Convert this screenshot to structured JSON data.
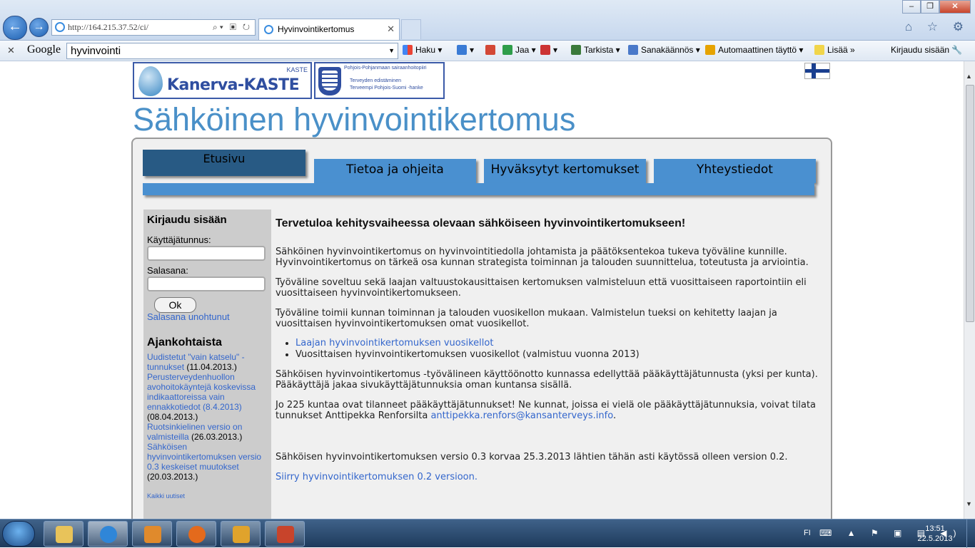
{
  "browser": {
    "address": "http://164.215.37.52/ci/",
    "tab_title": "Hyvinvointikertomus",
    "window_buttons": [
      "–",
      "❐",
      "✕"
    ],
    "right_icons": "⌂ ☆ ⚙"
  },
  "google_bar": {
    "logo": "Google",
    "search_value": "hyvinvointi",
    "items": {
      "haku": "Haku ▾",
      "jaa": "Jaa ▾",
      "tarkista": "Tarkista ▾",
      "sanakaannos": "Sanakäännös ▾",
      "autofill": "Automaattinen täyttö ▾",
      "lisaa": "Lisää »",
      "login": "Kirjaudu sisään"
    }
  },
  "header": {
    "logo1_name": "Kanerva-KASTE",
    "logo1_tag": "KASTE",
    "logo2_line1": "Pohjois-Pohjanmaan sairaanhoitopiiri",
    "logo2_line2": "Terveyden edistäminen",
    "logo2_line3": "Terveempi Pohjois-Suomi -hanke",
    "site_title": "Sähköinen hyvinvointikertomus"
  },
  "tabs": [
    "Etusivu",
    "Tietoa ja ohjeita",
    "Hyväksytyt kertomukset",
    "Yhteystiedot"
  ],
  "login": {
    "heading": "Kirjaudu sisään",
    "username_label": "Käyttäjätunnus:",
    "password_label": "Salasana:",
    "ok_label": "Ok",
    "forgot": "Salasana unohtunut"
  },
  "news": {
    "heading": "Ajankohtaista",
    "items": [
      {
        "link": "Uudistetut \"vain katselu\" -tunnukset",
        "date": " (11.04.2013.)"
      },
      {
        "link": "Perusterveydenhuollon avohoitokäyntejä koskevissa indikaattoreissa vain ennakkotiedot (8.4.2013)",
        "date": " (08.04.2013.)"
      },
      {
        "link": "Ruotsinkielinen versio on valmisteilla",
        "date": " (26.03.2013.)"
      },
      {
        "link": "Sähköisen hyvinvointikertomuksen versio 0.3 keskeiset muutokset",
        "date": " (20.03.2013.)"
      }
    ],
    "all": "Kaikki uutiset"
  },
  "main": {
    "heading": "Tervetuloa kehitysvaiheessa olevaan sähköiseen hyvinvointikertomukseen!",
    "p1": "Sähköinen hyvinvointikertomus on hyvinvointitiedolla johtamista ja päätöksentekoa tukeva työväline kunnille. Hyvinvointikertomus on tärkeä osa kunnan strategista toiminnan ja talouden suunnittelua, toteutusta ja arviointia.",
    "p2": "Työväline soveltuu sekä laajan valtuustokausittaisen kertomuksen valmisteluun että vuosittaiseen raportointiin eli vuosittaiseen hyvinvointikertomukseen.",
    "p3": "Työväline toimii kunnan toiminnan ja talouden vuosikellon mukaan. Valmistelun tueksi on kehitetty laajan ja vuosittaisen hyvinvointikertomuksen omat vuosikellot.",
    "li1": "Laajan hyvinvointikertomuksen vuosikellot",
    "li2": "Vuosittaisen hyvinvointikertomuksen vuosikellot (valmistuu vuonna 2013)",
    "p4": "Sähköisen hyvinvointikertomus -työvälineen käyttöönotto kunnassa edellyttää pääkäyttäjätunnusta (yksi per kunta). Pääkäyttäjä jakaa sivukäyttäjätunnuksia oman kuntansa sisällä.",
    "p5_text": "Jo 225 kuntaa ovat tilanneet pääkäyttäjätunnukset! Ne kunnat, joissa ei vielä ole pääkäyttäjätunnuksia, voivat tilata tunnukset Anttipekka Renforsilta ",
    "p5_email": "anttipekka.renfors@kansanterveys.info",
    "p5_end": ".",
    "p6": "Sähköisen hyvinvointikertomuksen versio 0.3 korvaa 25.3.2013 lähtien tähän asti käytössä olleen version 0.2.",
    "p7": "Siirry hyvinvointikertomuksen 0.2 versioon."
  },
  "taskbar": {
    "lang": "FI",
    "time": "13:51",
    "date": "22.5.2013"
  }
}
